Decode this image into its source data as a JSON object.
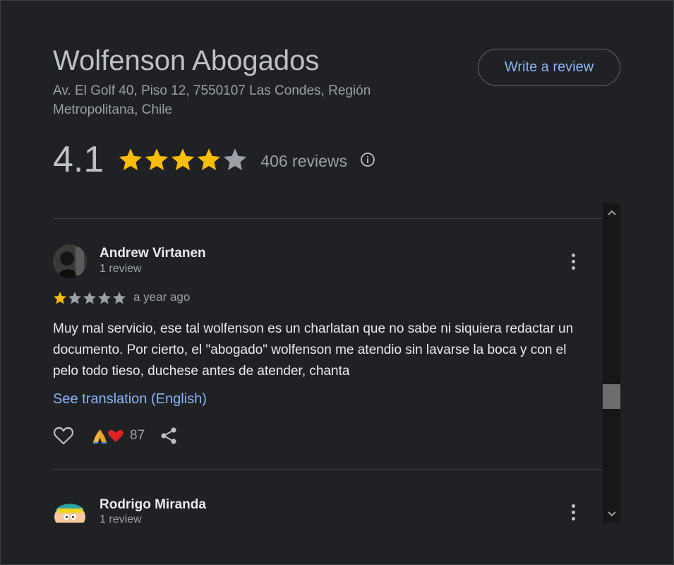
{
  "business": {
    "name": "Wolfenson Abogados",
    "address": "Av. El Golf 40, Piso 12, 7550107 Las Condes, Región Metropolitana, Chile",
    "write_review_label": "Write a review",
    "rating": "4.1",
    "rating_value": 4.1,
    "review_count_label": "406 reviews"
  },
  "reviews": [
    {
      "name": "Andrew Virtanen",
      "meta": "1 review",
      "stars": 1,
      "time": "a year ago",
      "text": "Muy mal servicio, ese tal wolfenson es un charlatan que no sabe ni siquiera redactar un documento. Por cierto, el \"abogado\" wolfenson me atendio sin lavarse la boca y con el pelo todo tieso, duchese antes de atender, chanta",
      "translate_label": "See translation (English)",
      "reaction_count": "87"
    },
    {
      "name": "Rodrigo Miranda",
      "meta": "1 review"
    }
  ],
  "colors": {
    "background": "#202124",
    "star_filled": "#fbbc04",
    "star_empty": "#9aa0a6",
    "link": "#8ab4f8"
  },
  "icons": {
    "info": "info-icon",
    "like": "heart-outline-icon",
    "share": "share-icon",
    "more": "more-vert-icon",
    "reactions": "pray-and-heart-emoji"
  }
}
